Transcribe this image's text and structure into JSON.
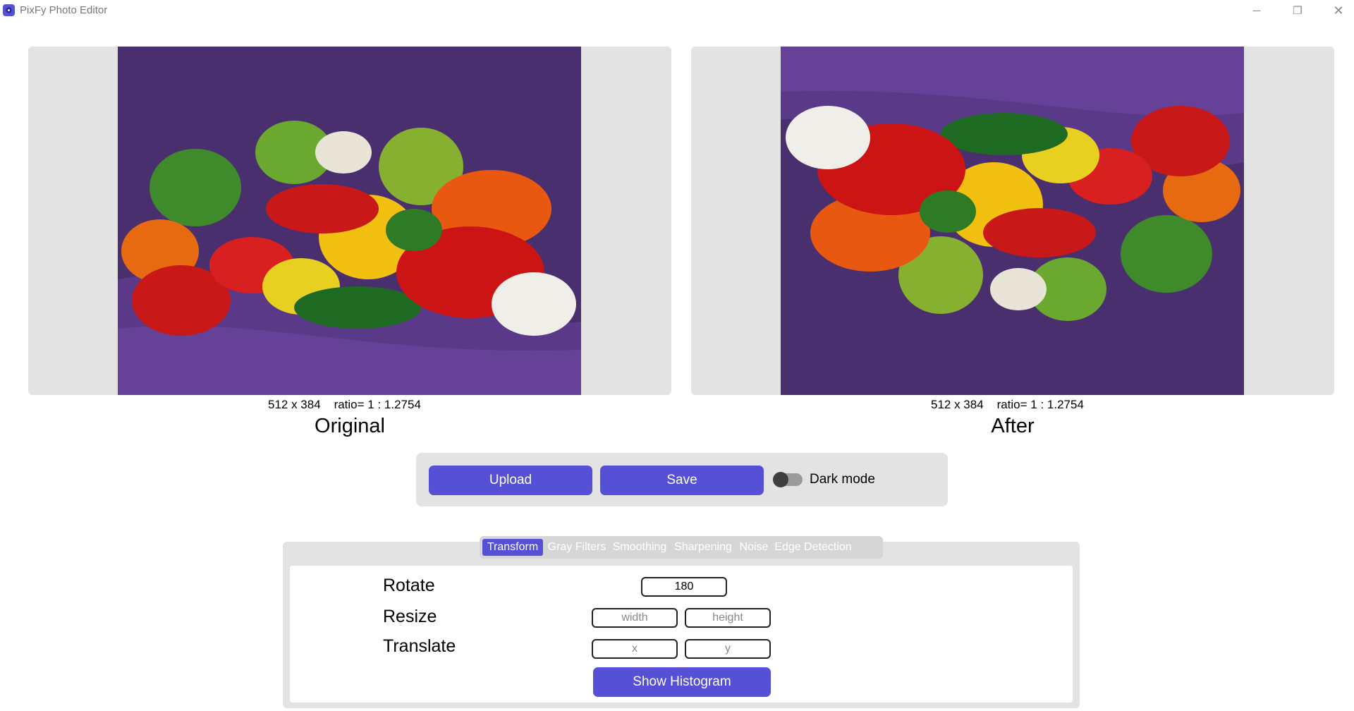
{
  "window": {
    "title": "PixFy Photo Editor",
    "minimize": "─",
    "restore": "❐",
    "close": "✕"
  },
  "original": {
    "dims": "512 x 384    ratio= 1 : 1.2754",
    "caption": "Original"
  },
  "after": {
    "dims": "512 x 384    ratio= 1 : 1.2754",
    "caption": "After"
  },
  "actions": {
    "upload_label": "Upload",
    "save_label": "Save",
    "dark_mode_label": "Dark mode",
    "dark_mode_on": false
  },
  "tabs": [
    {
      "label": "Transform",
      "active": true
    },
    {
      "label": "Gray Filters",
      "active": false
    },
    {
      "label": "Smoothing",
      "active": false
    },
    {
      "label": "Sharpening",
      "active": false
    },
    {
      "label": "Noise",
      "active": false
    },
    {
      "label": "Edge Detection",
      "active": false
    }
  ],
  "transform": {
    "rotate_label": "Rotate",
    "rotate_value": "180",
    "resize_label": "Resize",
    "width_placeholder": "width",
    "height_placeholder": "height",
    "translate_label": "Translate",
    "x_placeholder": "x",
    "y_placeholder": "y",
    "histogram_label": "Show Histogram"
  },
  "colors": {
    "accent": "#5650d6",
    "panel_bg": "#e3e3e3",
    "cloth": "#4a2f6e"
  }
}
